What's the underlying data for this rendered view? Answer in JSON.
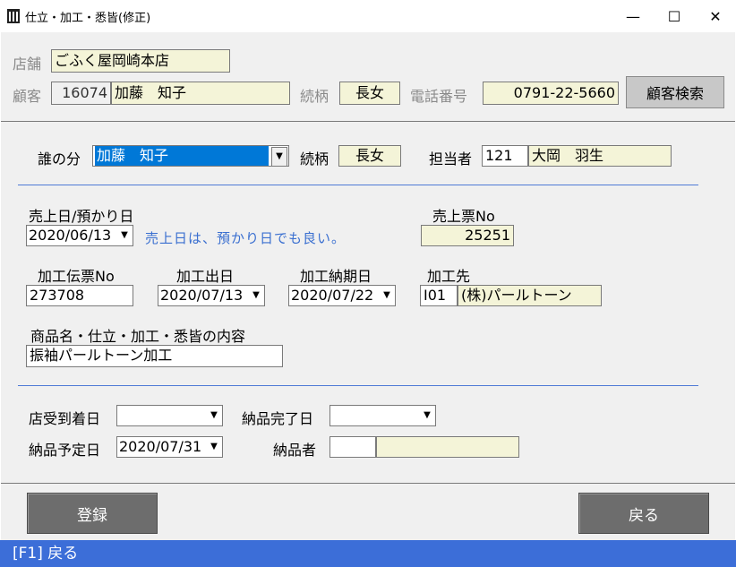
{
  "window": {
    "title": "仕立・加工・悉皆(修正)",
    "minimize": "—",
    "maximize": "☐",
    "close": "✕"
  },
  "header": {
    "store_label": "店舗",
    "store_value": "ごふく屋岡崎本店",
    "customer_label": "顧客",
    "customer_id": "16074",
    "customer_name": "加藤　知子",
    "relation_label": "続柄",
    "relation_value": "長女",
    "phone_label": "電話番号",
    "phone_value": "0791-22-5660",
    "search_button": "顧客検索"
  },
  "main": {
    "for_whom_label": "誰の分",
    "for_whom_value": "加藤　知子",
    "relation_label": "続柄",
    "relation_value": "長女",
    "staff_label": "担当者",
    "staff_id": "121",
    "staff_name": "大岡　羽生",
    "sale_date_label": "売上日/預かり日",
    "sale_date_value": "2020/06/13",
    "sale_note": "売上日は、預かり日でも良い。",
    "sale_no_label": "売上票No",
    "sale_no_value": "25251",
    "slip_no_label": "加工伝票No",
    "slip_no_value": "273708",
    "out_date_label": "加工出日",
    "out_date_value": "2020/07/13",
    "due_date_label": "加工納期日",
    "due_date_value": "2020/07/22",
    "vendor_label": "加工先",
    "vendor_code": "I01",
    "vendor_name": "(株)パールトーン",
    "content_label": "商品名・仕立・加工・悉皆の内容",
    "content_value": "振袖パールトーン加工",
    "arrival_label": "店受到着日",
    "arrival_value": "",
    "delivered_label": "納品完了日",
    "delivered_value": "",
    "planned_label": "納品予定日",
    "planned_value": "2020/07/31",
    "deliverer_label": "納品者",
    "deliverer_id": "",
    "deliverer_name": ""
  },
  "footer": {
    "register_button": "登録",
    "back_button": "戻る"
  },
  "status_bar": {
    "text": "[F1] 戻る"
  },
  "colors": {
    "accent": "#3c6ed8",
    "readonly_bg": "#f4f4d8",
    "selection": "#0078d7"
  }
}
